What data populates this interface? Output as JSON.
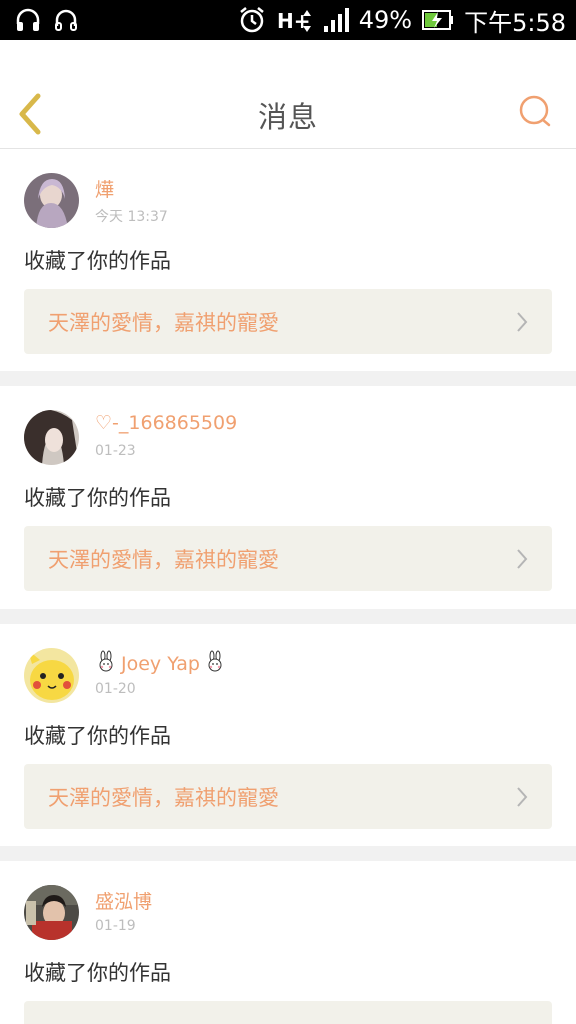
{
  "status_bar": {
    "battery": "49%",
    "time": "下午5:58",
    "network": "H+"
  },
  "header": {
    "title": "消息",
    "back_icon": "chevron-left-icon",
    "search_icon": "search-icon"
  },
  "colors": {
    "accent": "#f0a070",
    "back_arrow": "#d8b84a",
    "card_bg": "#f2f1ea",
    "separator": "#f1f1f1"
  },
  "messages": [
    {
      "username": "燁",
      "time": "今天 13:37",
      "action": "收藏了你的作品",
      "work_title": "天澤的愛情，嘉祺的寵愛"
    },
    {
      "username": "♡-_166865509",
      "time": "01-23",
      "action": "收藏了你的作品",
      "work_title": "天澤的愛情，嘉祺的寵愛"
    },
    {
      "username": "Joey Yap",
      "time": "01-20",
      "action": "收藏了你的作品",
      "work_title": "天澤的愛情，嘉祺的寵愛"
    },
    {
      "username": "盛泓博",
      "time": "01-19",
      "action": "收藏了你的作品",
      "work_title": ""
    }
  ]
}
